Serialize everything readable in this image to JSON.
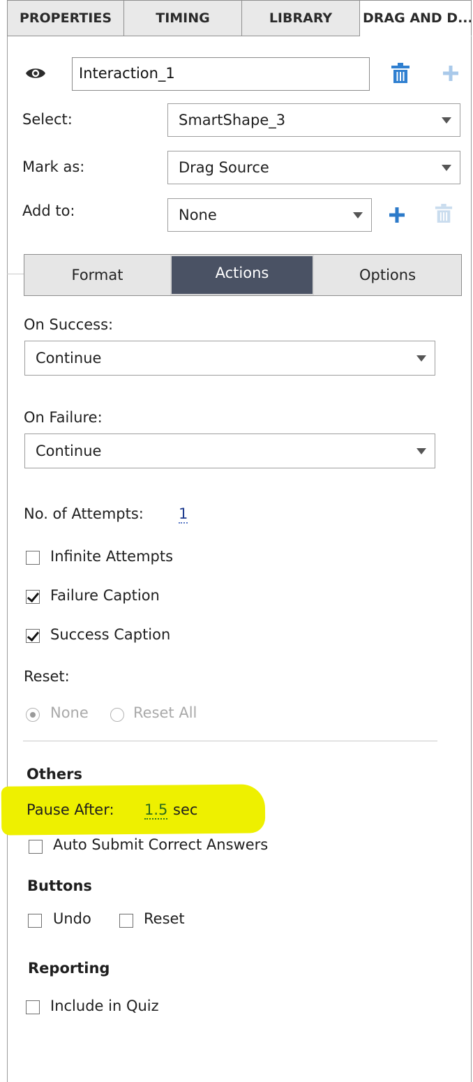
{
  "tabs": [
    {
      "label": "PROPERTIES"
    },
    {
      "label": "TIMING"
    },
    {
      "label": "LIBRARY"
    },
    {
      "label": "DRAG AND D..."
    }
  ],
  "interaction": {
    "name": "Interaction_1"
  },
  "select": {
    "label": "Select:",
    "value": "SmartShape_3"
  },
  "mark_as": {
    "label": "Mark as:",
    "value": "Drag Source"
  },
  "add_to": {
    "label": "Add to:",
    "value": "None"
  },
  "segments": [
    {
      "label": "Format"
    },
    {
      "label": "Actions"
    },
    {
      "label": "Options"
    }
  ],
  "on_success": {
    "label": "On Success:",
    "value": "Continue"
  },
  "on_failure": {
    "label": "On Failure:",
    "value": "Continue"
  },
  "attempts": {
    "label": "No. of Attempts:",
    "value": "1"
  },
  "checkboxes": {
    "infinite_attempts": {
      "label": "Infinite Attempts",
      "checked": false
    },
    "failure_caption": {
      "label": "Failure Caption",
      "checked": true
    },
    "success_caption": {
      "label": "Success Caption",
      "checked": true
    },
    "auto_submit": {
      "label": "Auto Submit Correct Answers",
      "checked": false
    },
    "undo": {
      "label": "Undo",
      "checked": false
    },
    "reset": {
      "label": "Reset",
      "checked": false
    },
    "include_in_quiz": {
      "label": "Include in Quiz",
      "checked": false
    }
  },
  "reset": {
    "label": "Reset:",
    "options": [
      {
        "label": "None",
        "selected": true
      },
      {
        "label": "Reset All",
        "selected": false
      }
    ]
  },
  "others": {
    "heading": "Others",
    "pause_label": "Pause After:",
    "pause_value": "1.5",
    "pause_unit": "sec"
  },
  "buttons": {
    "heading": "Buttons"
  },
  "reporting": {
    "heading": "Reporting"
  },
  "colors": {
    "accent_blue": "#2c7ac9",
    "active_segment": "#4a5264",
    "highlight": "#eef000"
  },
  "icons": {
    "visibility": "eye-icon",
    "delete": "trash-icon",
    "add": "plus-icon"
  }
}
